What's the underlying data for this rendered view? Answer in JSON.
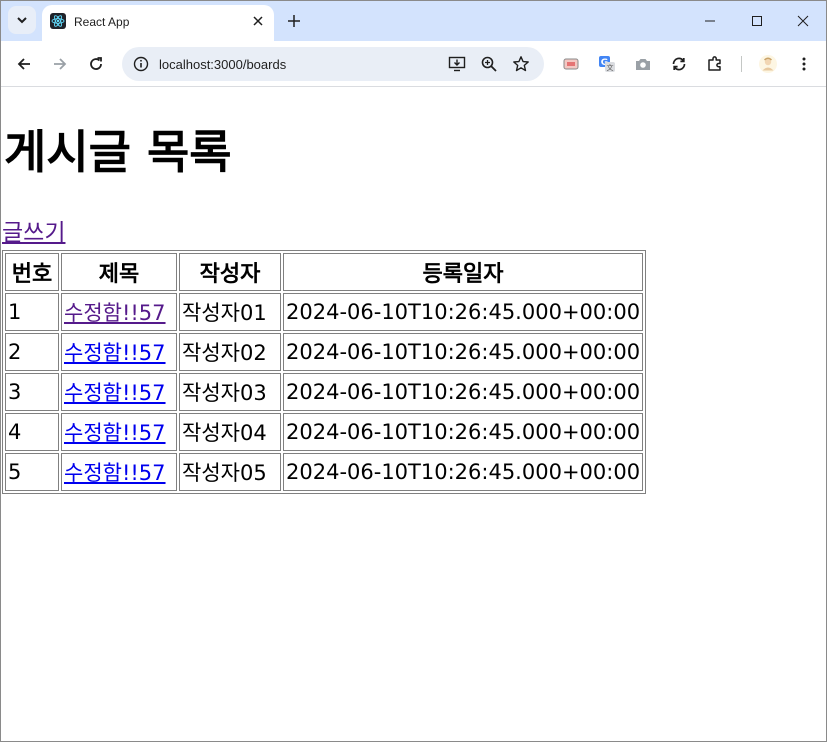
{
  "browser": {
    "tab_title": "React App",
    "url": "localhost:3000/boards"
  },
  "page": {
    "heading": "게시글 목록",
    "write_link": "글쓰기",
    "table": {
      "headers": [
        "번호",
        "제목",
        "작성자",
        "등록일자"
      ],
      "rows": [
        {
          "num": "1",
          "title": "수정함!!57",
          "author": "작성자01",
          "date": "2024-06-10T10:26:45.000+00:00",
          "visited": true
        },
        {
          "num": "2",
          "title": "수정함!!57",
          "author": "작성자02",
          "date": "2024-06-10T10:26:45.000+00:00",
          "visited": false
        },
        {
          "num": "3",
          "title": "수정함!!57",
          "author": "작성자03",
          "date": "2024-06-10T10:26:45.000+00:00",
          "visited": false
        },
        {
          "num": "4",
          "title": "수정함!!57",
          "author": "작성자04",
          "date": "2024-06-10T10:26:45.000+00:00",
          "visited": false
        },
        {
          "num": "5",
          "title": "수정함!!57",
          "author": "작성자05",
          "date": "2024-06-10T10:26:45.000+00:00",
          "visited": false
        }
      ]
    }
  },
  "colors": {
    "titlebar": "#d3e3fd",
    "omnibox": "#e9eef6",
    "link": "#0000ee",
    "visited_link": "#551a8b"
  },
  "icons": {
    "tab_menu": "chevron-down-icon",
    "favicon": "react-icon",
    "tab_close": "close-icon",
    "new_tab": "plus-icon",
    "minimize": "minimize-icon",
    "maximize": "maximize-icon",
    "close_window": "close-icon",
    "back": "arrow-left-icon",
    "forward": "arrow-right-icon",
    "reload": "reload-icon",
    "site_info": "info-icon",
    "install": "install-app-icon",
    "zoom": "zoom-icon",
    "bookmark": "star-icon",
    "ext1": "extension-icon",
    "translate": "translate-icon",
    "camera": "camera-icon",
    "sync": "sync-icon",
    "extensions": "puzzle-icon",
    "profile": "avatar",
    "menu": "kebab-menu-icon"
  }
}
